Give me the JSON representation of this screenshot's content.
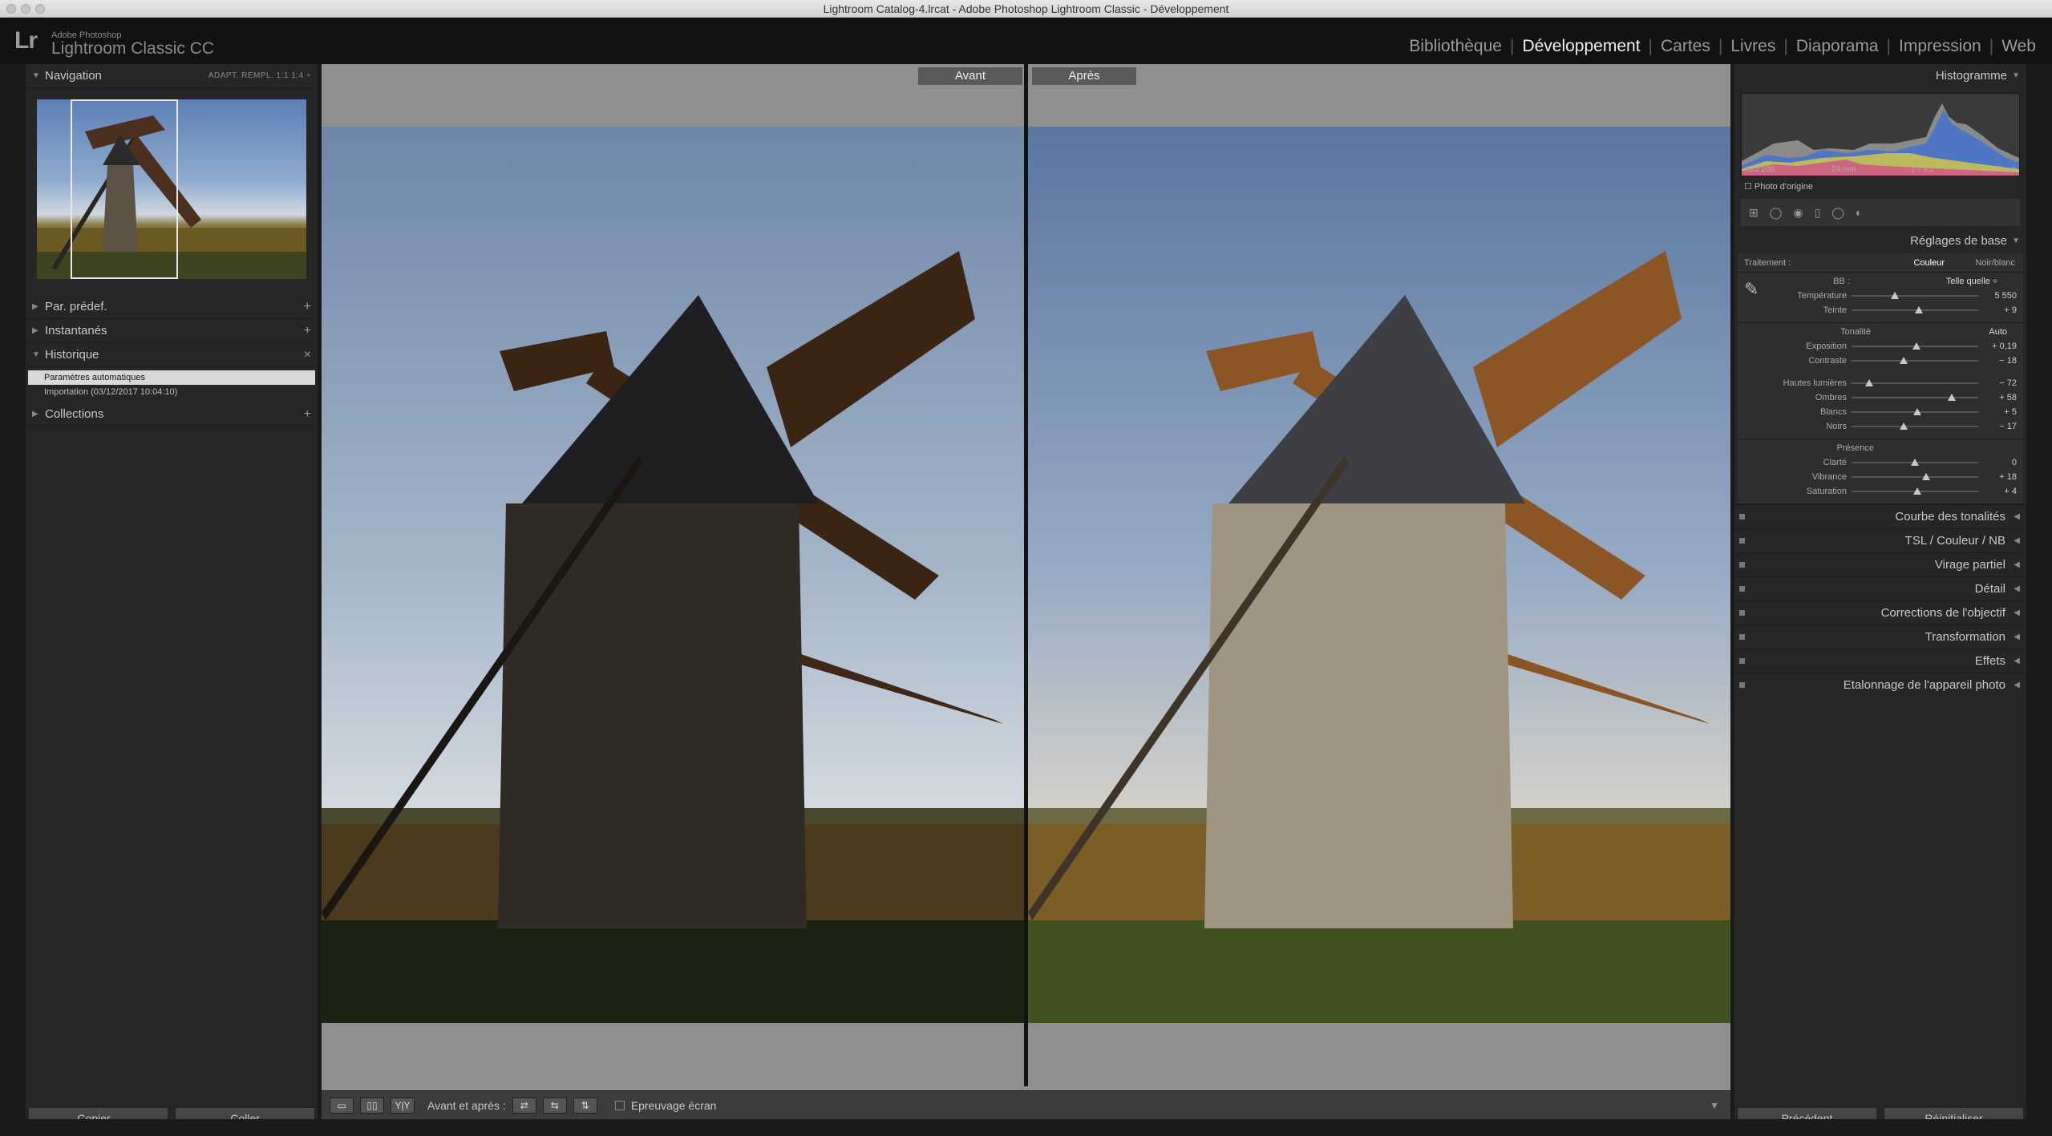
{
  "window": {
    "title": "Lightroom Catalog-4.lrcat - Adobe Photoshop Lightroom Classic - Développement"
  },
  "brand": {
    "logo": "Lr",
    "line1": "Adobe Photoshop",
    "line2": "Lightroom Classic CC"
  },
  "modules": [
    {
      "label": "Bibliothèque"
    },
    {
      "label": "Développement",
      "active": true
    },
    {
      "label": "Cartes"
    },
    {
      "label": "Livres"
    },
    {
      "label": "Diaporama"
    },
    {
      "label": "Impression"
    },
    {
      "label": "Web"
    }
  ],
  "left": {
    "navigation": {
      "title": "Navigation",
      "zoom_options": "ADAPT.   REMPL.   1:1   1:4 ÷"
    },
    "presets": {
      "title": "Par. prédef.",
      "action": "+"
    },
    "snapshots": {
      "title": "Instantanés",
      "action": "+"
    },
    "history": {
      "title": "Historique",
      "action": "×",
      "items": [
        {
          "label": "Paramètres automatiques",
          "selected": true
        },
        {
          "label": "Importation (03/12/2017 10:04:10)"
        }
      ]
    },
    "collections": {
      "title": "Collections",
      "action": "+"
    },
    "buttons": {
      "copy": "Copier...",
      "paste": "Coller"
    }
  },
  "center": {
    "before_label": "Avant",
    "after_label": "Après",
    "toolbar": {
      "before_after": "Avant et après :",
      "yy": "Y|Y",
      "softproof": "Epreuvage écran"
    }
  },
  "right": {
    "histogram": {
      "title": "Histogramme",
      "iso": "ISO 100",
      "focal": "24 mm",
      "aperture": "ƒ / 9,0",
      "shutter": "¹⁄₄₀₀ s",
      "original": "Photo d'origine"
    },
    "basic": {
      "title": "Réglages de base",
      "treatment_label": "Traitement :",
      "color": "Couleur",
      "bw": "Noir/blanc",
      "wb_label": "BB :",
      "wb_value": "Telle quelle ÷",
      "tone_label": "Tonalité",
      "auto": "Auto",
      "presence_label": "Présence",
      "sliders_wb": [
        {
          "label": "Température",
          "value": "5 550",
          "pos": 0.34
        },
        {
          "label": "Teinte",
          "value": "+ 9",
          "pos": 0.53
        }
      ],
      "sliders_tone1": [
        {
          "label": "Exposition",
          "value": "+ 0,19",
          "pos": 0.51
        },
        {
          "label": "Contraste",
          "value": "− 18",
          "pos": 0.41
        }
      ],
      "sliders_tone2": [
        {
          "label": "Hautes lumières",
          "value": "− 72",
          "pos": 0.14
        },
        {
          "label": "Ombres",
          "value": "+ 58",
          "pos": 0.79
        },
        {
          "label": "Blancs",
          "value": "+ 5",
          "pos": 0.52
        },
        {
          "label": "Noirs",
          "value": "− 17",
          "pos": 0.41
        }
      ],
      "sliders_presence": [
        {
          "label": "Clarté",
          "value": "0",
          "pos": 0.5
        },
        {
          "label": "Vibrance",
          "value": "+ 18",
          "pos": 0.59
        },
        {
          "label": "Saturation",
          "value": "+ 4",
          "pos": 0.52
        }
      ]
    },
    "panels": [
      {
        "label": "Courbe des tonalités"
      },
      {
        "label": "TSL  /  Couleur  /  NB"
      },
      {
        "label": "Virage partiel"
      },
      {
        "label": "Détail"
      },
      {
        "label": "Corrections de l'objectif"
      },
      {
        "label": "Transformation"
      },
      {
        "label": "Effets"
      },
      {
        "label": "Etalonnage de l'appareil photo"
      }
    ],
    "buttons": {
      "previous": "Précédent",
      "reset": "Réinitialiser"
    }
  }
}
